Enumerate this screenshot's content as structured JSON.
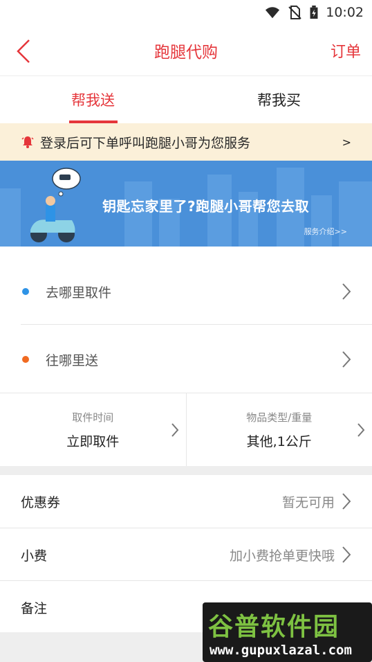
{
  "status_bar": {
    "time": "10:02"
  },
  "nav": {
    "title": "跑腿代购",
    "orders": "订单"
  },
  "tabs": [
    {
      "label": "帮我送",
      "active": true
    },
    {
      "label": "帮我买",
      "active": false
    }
  ],
  "notice": {
    "text": "登录后可下单呼叫跑腿小哥为您服务",
    "arrow": ">"
  },
  "banner": {
    "headline": "钥匙忘家里了?跑腿小哥帮您去取",
    "link": "服务介绍>>"
  },
  "address": {
    "pickup": {
      "label": "去哪里取件",
      "dot_color": "#2e93e6"
    },
    "dropoff": {
      "label": "往哪里送",
      "dot_color": "#f06a21"
    }
  },
  "info": {
    "time": {
      "caption": "取件时间",
      "value": "立即取件"
    },
    "item": {
      "caption": "物品类型/重量",
      "value": "其他,1公斤"
    }
  },
  "rows": {
    "coupon": {
      "label": "优惠券",
      "value": "暂无可用"
    },
    "tip": {
      "label": "小费",
      "value": "加小费抢单更快哦"
    },
    "remark": {
      "label": "备注",
      "value": ""
    }
  },
  "watermark": {
    "brand": "谷普软件园",
    "url": "www.gupuxlazal.com"
  },
  "colors": {
    "accent": "#e5363b",
    "banner": "#4a90d9",
    "notice_bg": "#fbf0d9"
  }
}
